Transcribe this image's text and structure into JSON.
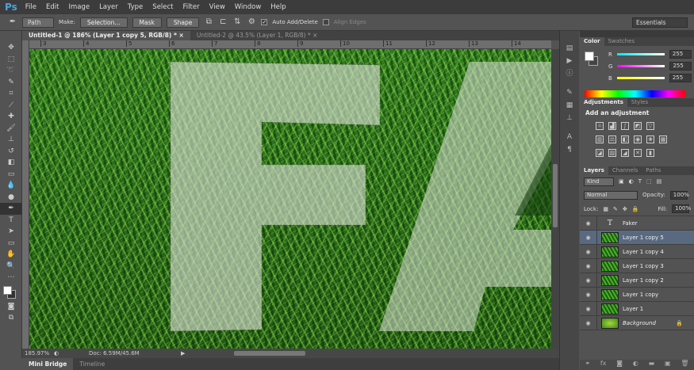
{
  "app": {
    "logo": "Ps"
  },
  "menu": [
    "File",
    "Edit",
    "Image",
    "Layer",
    "Type",
    "Select",
    "Filter",
    "View",
    "Window",
    "Help"
  ],
  "options": {
    "mode": "Path",
    "make_label": "Make:",
    "selection": "Selection...",
    "mask": "Mask",
    "shape": "Shape",
    "auto_add_delete": "Auto Add/Delete",
    "auto_checked": true,
    "align_edges": "Align Edges",
    "workspace": "Essentials"
  },
  "tabs": [
    {
      "label": "Untitled-1 @ 186% (Layer 1 copy 5, RGB/8) *",
      "active": true
    },
    {
      "label": "Untitled-2 @ 43.5% (Layer 1, RGB/8) *",
      "active": false
    }
  ],
  "ruler": [
    "3",
    "4",
    "5",
    "6",
    "7",
    "8",
    "9",
    "10",
    "11",
    "12",
    "13",
    "14"
  ],
  "status": {
    "zoom": "185.97%",
    "doc": "Doc: 6.59M/45.6M"
  },
  "bottom_tabs": [
    "Mini Bridge",
    "Timeline"
  ],
  "color_panel": {
    "tabs": [
      "Color",
      "Swatches"
    ],
    "channels": [
      {
        "label": "R",
        "value": "255",
        "color": "#00e5ff"
      },
      {
        "label": "G",
        "value": "255",
        "color": "#ff00ff"
      },
      {
        "label": "B",
        "value": "255",
        "color": "#ffff00"
      }
    ]
  },
  "adjustments": {
    "tabs": [
      "Adjustments",
      "Styles"
    ],
    "title": "Add an adjustment"
  },
  "layers": {
    "tabs": [
      "Layers",
      "Channels",
      "Paths"
    ],
    "kind": "Kind",
    "blend": "Normal",
    "opacity_label": "Opacity:",
    "opacity": "100%",
    "lock_label": "Lock:",
    "fill_label": "Fill:",
    "fill": "100%",
    "items": [
      {
        "name": "Faker",
        "type": "text"
      },
      {
        "name": "Layer 1 copy 5",
        "selected": true
      },
      {
        "name": "Layer 1 copy 4"
      },
      {
        "name": "Layer 1 copy 3"
      },
      {
        "name": "Layer 1 copy 2"
      },
      {
        "name": "Layer 1 copy"
      },
      {
        "name": "Layer 1"
      },
      {
        "name": "Background",
        "type": "background"
      }
    ]
  }
}
